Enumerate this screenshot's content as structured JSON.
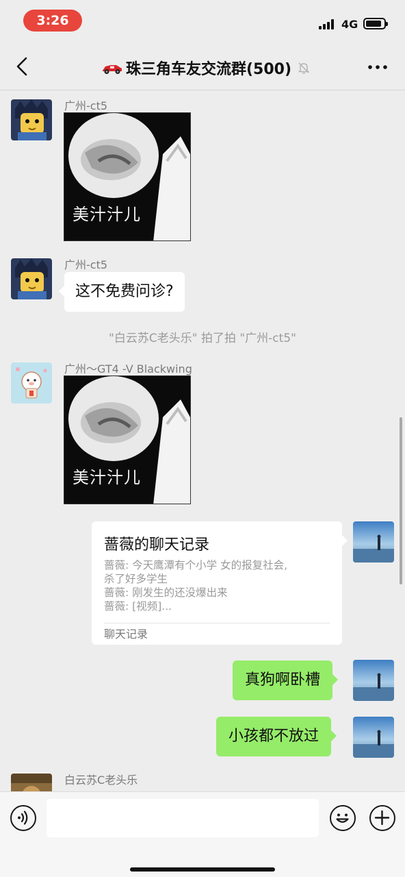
{
  "status_bar": {
    "time": "3:26",
    "network": "4G",
    "icons": [
      "signal-icon",
      "battery-icon"
    ]
  },
  "nav": {
    "back_icon": "chevron-left-icon",
    "title": "珠三角车友交流群(500)",
    "title_emoji": "racing-car-icon",
    "muted_icon": "bell-off-icon",
    "more_icon": "more-dots-icon"
  },
  "messages": [
    {
      "type": "sticker",
      "sender": "广州-ct5",
      "caption": "美汁汁儿"
    },
    {
      "type": "text",
      "sender": "广州-ct5",
      "text": "这不免费问诊?"
    },
    {
      "type": "system",
      "text": "\"白云苏C老头乐\" 拍了拍 \"广州-ct5\""
    },
    {
      "type": "sticker",
      "sender": "广州～GT4 -V Blackwing",
      "caption": "美汁汁儿"
    },
    {
      "type": "chat_record",
      "direction": "out",
      "title": "蔷薇的聊天记录",
      "lines": [
        "蔷薇: 今天鹰潭有个小学  女的报复社会,",
        "杀了好多学生",
        "蔷薇: 刚发生的还没爆出来",
        "蔷薇: [视频]..."
      ],
      "footer": "聊天记录"
    },
    {
      "type": "text",
      "direction": "out",
      "text": "真狗啊卧槽"
    },
    {
      "type": "text",
      "direction": "out",
      "text": "小孩都不放过"
    },
    {
      "type": "text",
      "sender": "白云苏C老头乐",
      "text": ""
    }
  ],
  "input_bar": {
    "voice_icon": "voice-icon",
    "emoji_icon": "emoji-icon",
    "plus_icon": "plus-icon",
    "placeholder": ""
  },
  "colors": {
    "time_pill": "#e8453c",
    "outgoing_bubble": "#95ec69",
    "incoming_bubble": "#ffffff",
    "chat_background": "#ededed"
  }
}
